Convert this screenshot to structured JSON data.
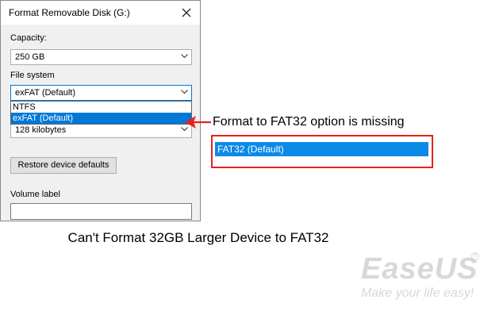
{
  "dialog": {
    "title": "Format Removable Disk (G:)",
    "capacity_label": "Capacity:",
    "capacity_value": "250 GB",
    "filesystem_label": "File system",
    "filesystem_value": "exFAT (Default)",
    "filesystem_options": [
      "NTFS",
      "exFAT (Default)"
    ],
    "allocation_value": "128 kilobytes",
    "restore_button": "Restore device defaults",
    "volume_label": "Volume label",
    "volume_value": ""
  },
  "annotation": {
    "text": "Format to FAT32 option is missing",
    "missing_option": "FAT32 (Default)",
    "arrow_color": "#e62020",
    "box_color": "#e62020"
  },
  "caption": "Can't Format 32GB Larger Device to FAT32",
  "watermark": {
    "brand": "EaseUS",
    "slogan": "Make your life easy!"
  },
  "colors": {
    "selection": "#0078d7",
    "highlight_item": "#0b8ae8"
  }
}
